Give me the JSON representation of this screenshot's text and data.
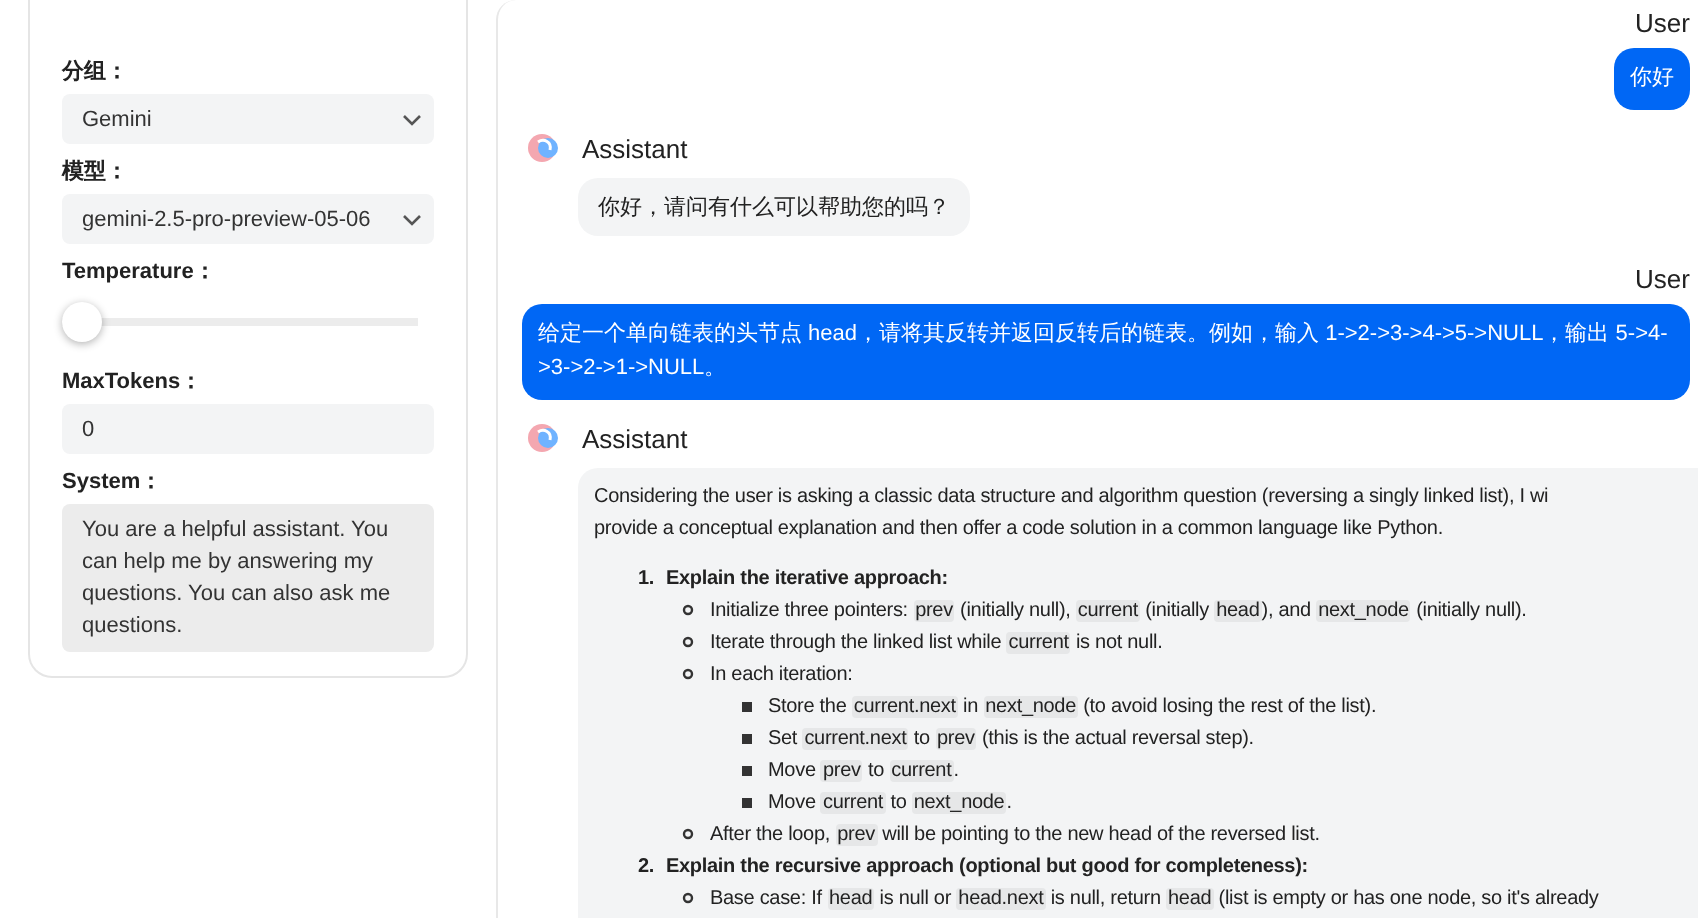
{
  "sidebar": {
    "fields": [
      {
        "kind": "select",
        "label": "分组：",
        "value": "Gemini"
      },
      {
        "kind": "select",
        "label": "模型：",
        "value": "gemini-2.5-pro-preview-05-06"
      },
      {
        "kind": "slider",
        "label": "Temperature：",
        "level": 0
      },
      {
        "kind": "input",
        "label": "MaxTokens：",
        "value": "0"
      },
      {
        "kind": "textarea",
        "label": "System：",
        "value": "You are a helpful assistant. You can help me by answering my questions. You can also ask me questions."
      }
    ]
  },
  "messages": [
    {
      "kind": "user",
      "name": "User",
      "text": "你好"
    },
    {
      "kind": "assistant",
      "name": "Assistant",
      "text": "你好，请问有什么可以帮助您的吗？"
    },
    {
      "kind": "user",
      "name": "User",
      "text": "给定一个单向链表的头节点 head，请将其反转并返回反转后的链表。例如，输入 1->2->3->4->5->NULL，输出 5->4->3->2->1->NULL。"
    },
    {
      "kind": "assistant",
      "name": "Assistant",
      "intro": [
        "Considering the user is asking a classic data structure and algorithm question (reversing a singly linked list), I wi",
        "provide a conceptual explanation and then offer a code solution in a common language like Python."
      ],
      "steps": [
        {
          "number": "1.",
          "title": "Explain the iterative approach:",
          "children": [
            {
              "parts": [
                {
                  "text": "Initialize three pointers: "
                },
                {
                  "code": "prev"
                },
                {
                  "text": " (initially null), "
                },
                {
                  "code": "current"
                },
                {
                  "text": " (initially "
                },
                {
                  "code": "head"
                },
                {
                  "text": "), and "
                },
                {
                  "code": "next_node"
                },
                {
                  "text": " (initially null)."
                }
              ]
            },
            {
              "parts": [
                {
                  "text": "Iterate through the linked list while "
                },
                {
                  "code": "current"
                },
                {
                  "text": " is not null."
                }
              ]
            },
            {
              "parts": [
                {
                  "text": "In each iteration:"
                }
              ],
              "children": [
                {
                  "parts": [
                    {
                      "text": "Store the "
                    },
                    {
                      "code": "current.next"
                    },
                    {
                      "text": " in "
                    },
                    {
                      "code": "next_node"
                    },
                    {
                      "text": " (to avoid losing the rest of the list)."
                    }
                  ]
                },
                {
                  "parts": [
                    {
                      "text": "Set "
                    },
                    {
                      "code": "current.next"
                    },
                    {
                      "text": " to "
                    },
                    {
                      "code": "prev"
                    },
                    {
                      "text": " (this is the actual reversal step)."
                    }
                  ]
                },
                {
                  "parts": [
                    {
                      "text": "Move "
                    },
                    {
                      "code": "prev"
                    },
                    {
                      "text": " to "
                    },
                    {
                      "code": "current"
                    },
                    {
                      "text": "."
                    }
                  ]
                },
                {
                  "parts": [
                    {
                      "text": "Move "
                    },
                    {
                      "code": "current"
                    },
                    {
                      "text": " to "
                    },
                    {
                      "code": "next_node"
                    },
                    {
                      "text": "."
                    }
                  ]
                }
              ]
            },
            {
              "parts": [
                {
                  "text": "After the loop, "
                },
                {
                  "code": "prev"
                },
                {
                  "text": " will be pointing to the new head of the reversed list."
                }
              ]
            }
          ]
        },
        {
          "number": "2.",
          "title": "Explain the recursive approach (optional but good for completeness):",
          "children": [
            {
              "parts": [
                {
                  "text": "Base case: If "
                },
                {
                  "code": "head"
                },
                {
                  "text": " is null or "
                },
                {
                  "code": "head.next"
                },
                {
                  "text": " is null, return "
                },
                {
                  "code": "head"
                },
                {
                  "text": " (list is empty or has one node, so it's already"
                }
              ]
            }
          ]
        }
      ]
    }
  ]
}
